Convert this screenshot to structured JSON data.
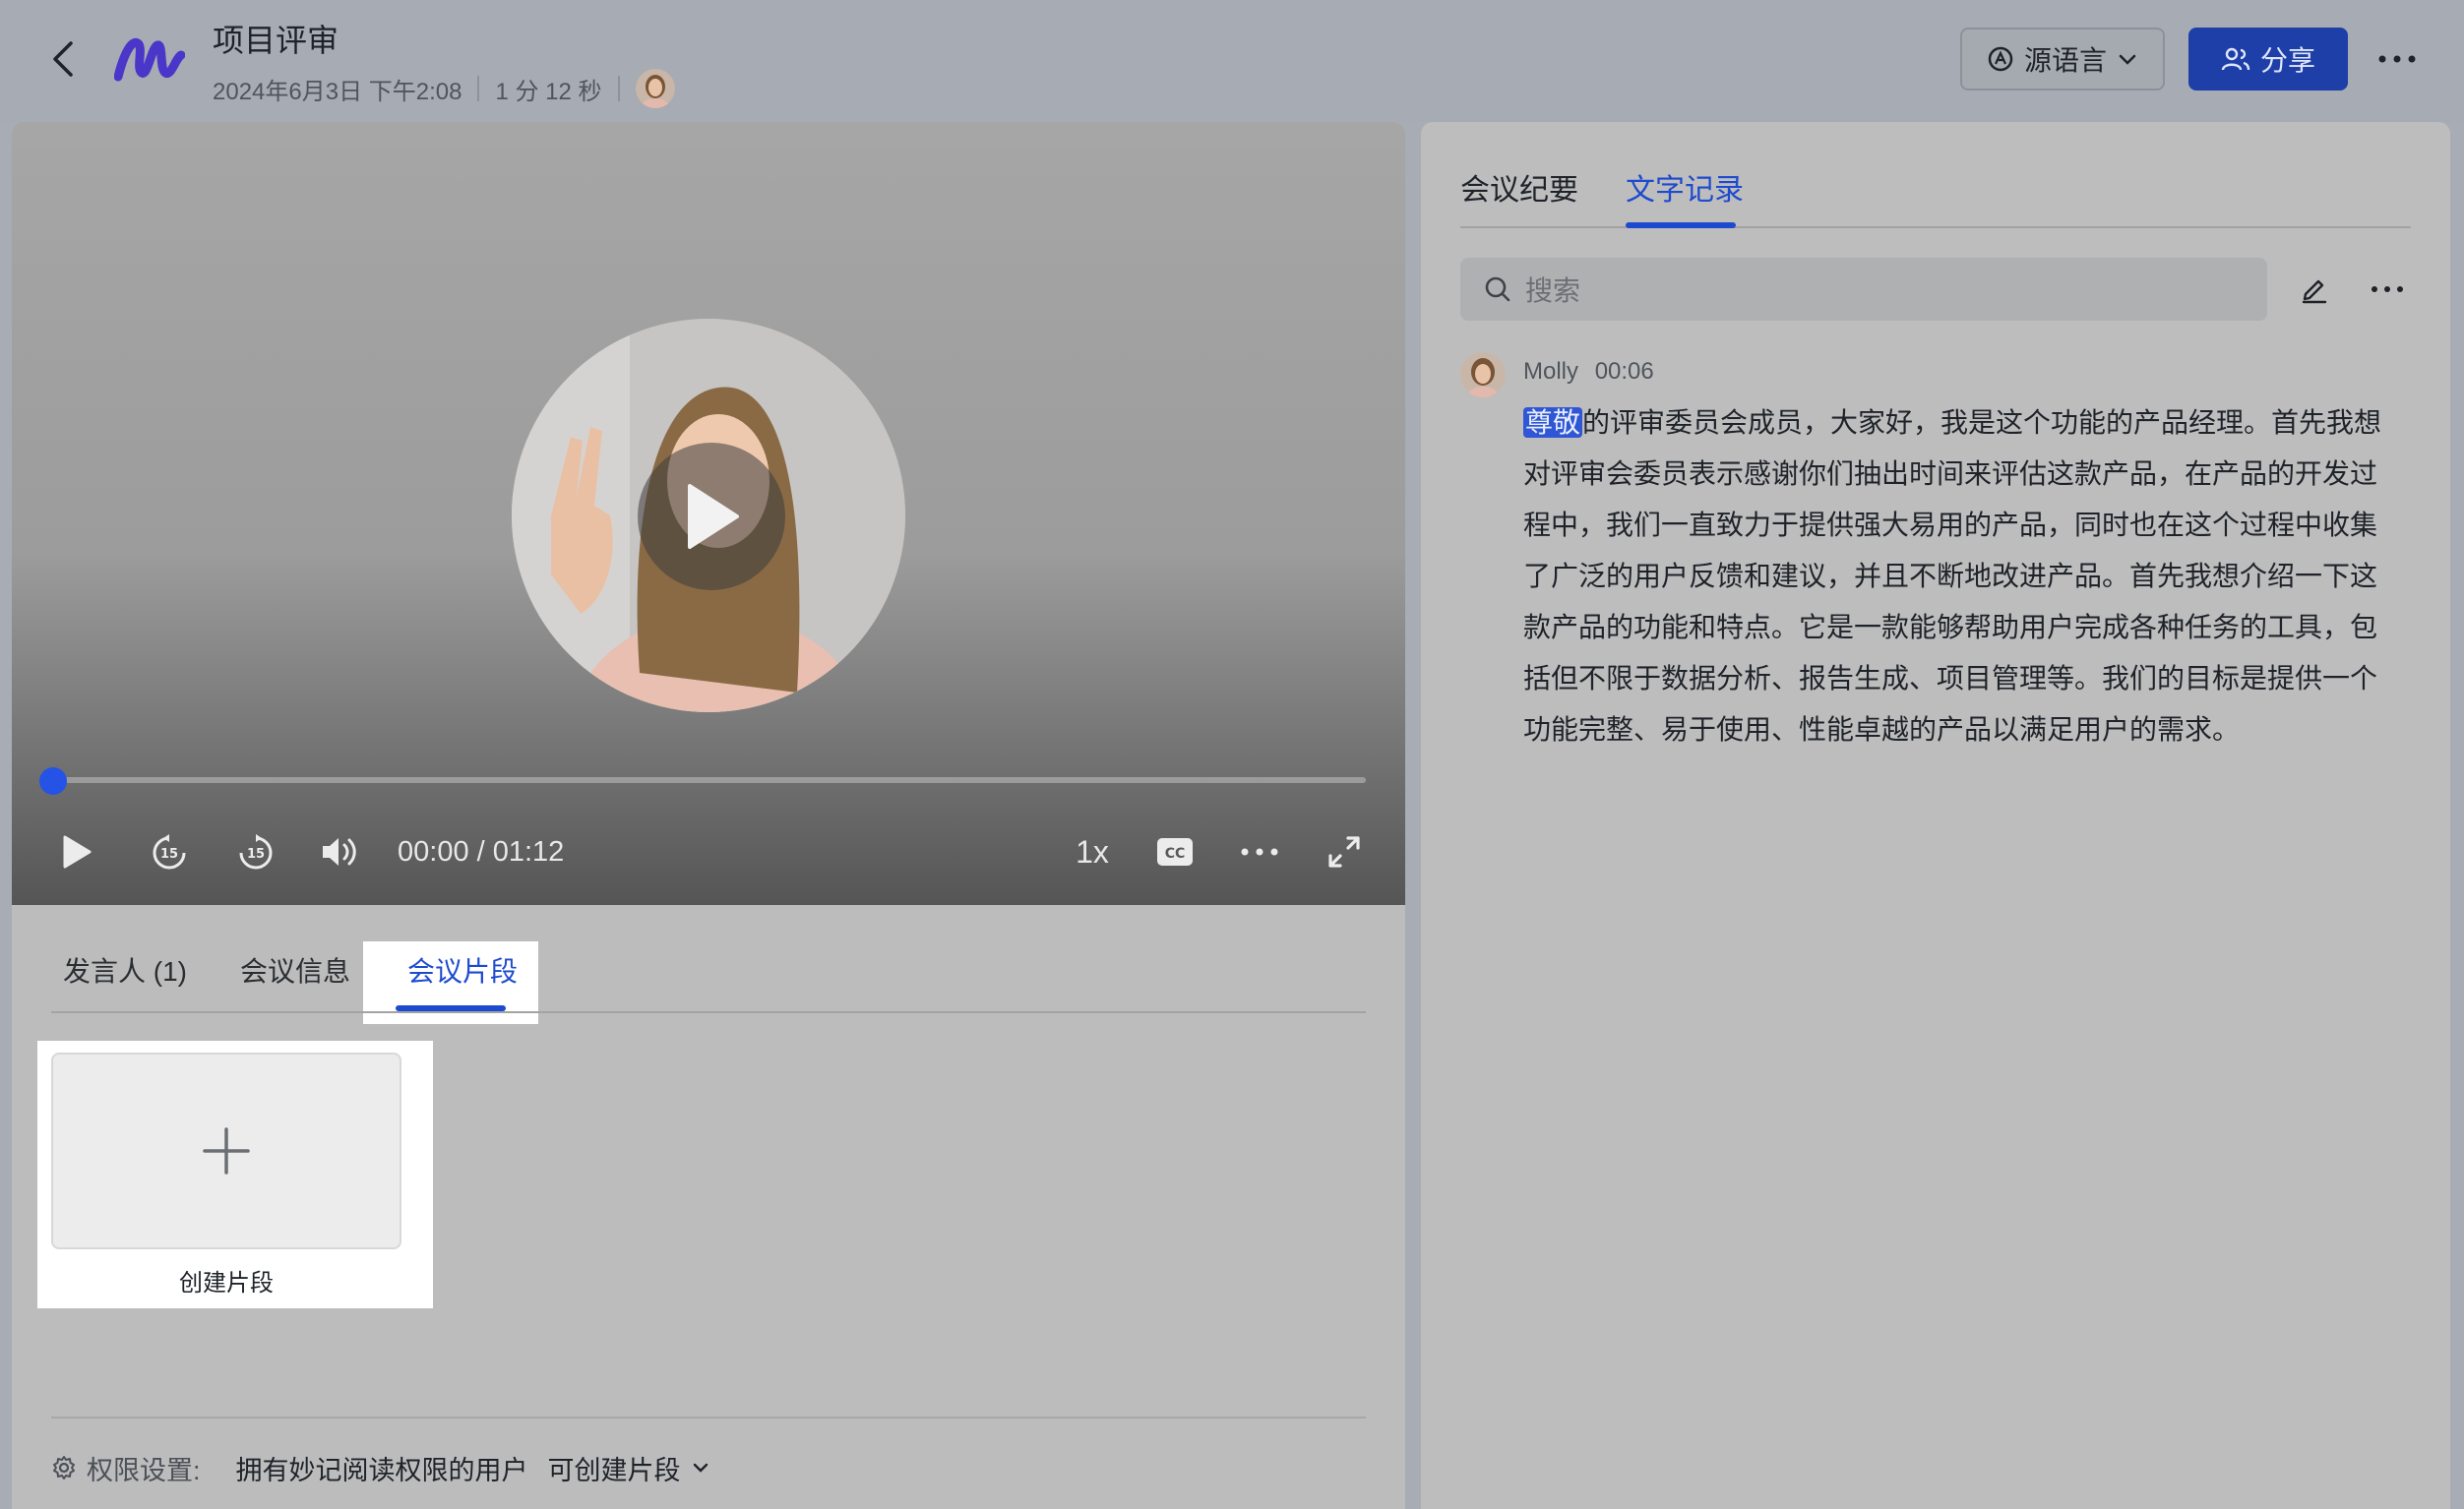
{
  "header": {
    "title": "项目评审",
    "date": "2024年6月3日 下午2:08",
    "duration": "1 分 12 秒",
    "lang_label": "源语言",
    "share_label": "分享"
  },
  "player": {
    "time": "00:00 / 01:12",
    "speed": "1x",
    "progress": 0
  },
  "left_tabs": [
    {
      "label": "发言人 (1)"
    },
    {
      "label": "会议信息"
    },
    {
      "label": "会议片段"
    }
  ],
  "clips": {
    "create_label": "创建片段"
  },
  "permission": {
    "label": "权限设置:",
    "value": "拥有妙记阅读权限的用户",
    "action": "可创建片段"
  },
  "right_tabs": [
    {
      "label": "会议纪要"
    },
    {
      "label": "文字记录"
    }
  ],
  "search": {
    "placeholder": "搜索"
  },
  "transcript": {
    "speaker": "Molly",
    "timestamp": "00:06",
    "highlight": "尊敬",
    "text": "的评审委员会成员，大家好，我是这个功能的产品经理。首先我想对评审会委员表示感谢你们抽出时间来评估这款产品，在产品的开发过程中，我们一直致力于提供强大易用的产品，同时也在这个过程中收集了广泛的用户反馈和建议，并且不断地改进产品。首先我想介绍一下这款产品的功能和特点。它是一款能够帮助用户完成各种任务的工具，包括但不限于数据分析、报告生成、项目管理等。我们的目标是提供一个功能完整、易于使用、性能卓越的产品以满足用户的需求。"
  },
  "colors": {
    "accent": "#1e4ad0",
    "share_bg": "#1e3ea8"
  }
}
